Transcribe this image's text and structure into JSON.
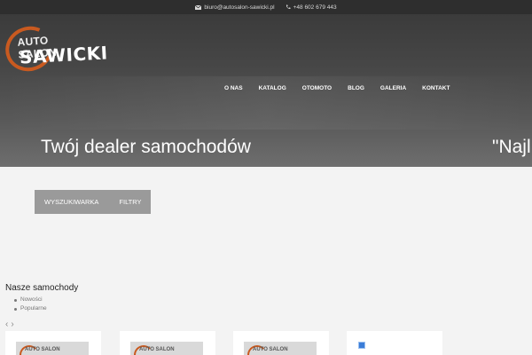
{
  "topbar": {
    "email": "biuro@autosalon-sawicki.pl",
    "phone": "+48 602 679 443"
  },
  "logo": {
    "line1": "AUTO SALON",
    "line2": "SAWICKI"
  },
  "nav": {
    "items": [
      "O NAS",
      "KATALOG",
      "OTOMOTO",
      "BLOG",
      "GALERIA",
      "KONTAKT"
    ]
  },
  "hero": {
    "headline": "Twój dealer samochodów",
    "headline2": "\"Najl"
  },
  "search_tabs": {
    "tab1": "WYSZUKIWARKA",
    "tab2": "FILTRY"
  },
  "cars": {
    "title": "Nasze samochody",
    "filters": [
      "Nowości",
      "Popularne"
    ],
    "prev_arrow": "‹",
    "next_arrow": "›",
    "cards": [
      {
        "logo_text": "AUTO SALON"
      },
      {
        "logo_text": "AUTO SALON"
      },
      {
        "logo_text": "AUTO SALON"
      },
      {
        "logo_text": ""
      }
    ]
  },
  "colors": {
    "accent": "#c95a20",
    "topbar_bg": "#2e2e2e",
    "tab_bg": "#9a9a9a"
  }
}
